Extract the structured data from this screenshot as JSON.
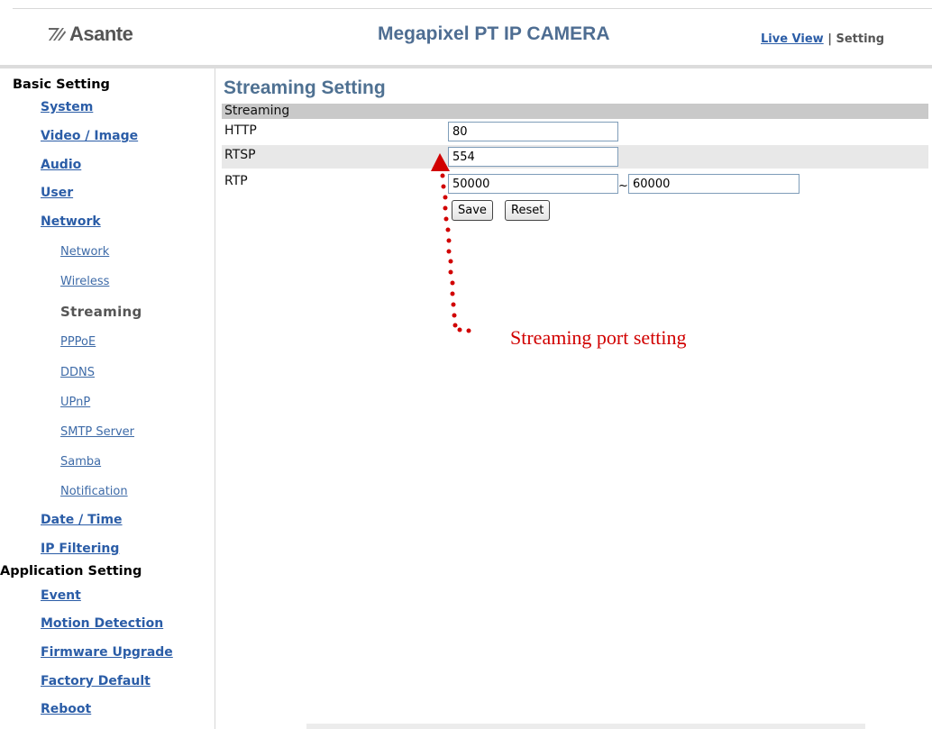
{
  "header": {
    "brand": "Asante",
    "product_title": "Megapixel PT IP CAMERA",
    "live_view_label": "Live View",
    "separator": " | ",
    "setting_label": "Setting"
  },
  "sidebar": {
    "basic_title": "Basic Setting",
    "app_title": "Application Setting",
    "items": {
      "system": "System",
      "video_image": "Video / Image",
      "audio": "Audio",
      "user": "User",
      "network": "Network",
      "network_sub": "Network",
      "wireless": "Wireless",
      "streaming": "Streaming",
      "pppoe": "PPPoE",
      "ddns": "DDNS",
      "upnp": "UPnP",
      "smtp": "SMTP Server",
      "samba": "Samba",
      "notification": "Notification",
      "date_time": "Date / Time",
      "ip_filtering": "IP Filtering",
      "event": "Event",
      "motion": "Motion Detection",
      "firmware": "Firmware Upgrade",
      "factory": "Factory Default",
      "reboot": "Reboot"
    }
  },
  "main": {
    "page_title": "Streaming Setting",
    "section_label": "Streaming",
    "rows": {
      "http_label": "HTTP",
      "http_value": "80",
      "rtsp_label": "RTSP",
      "rtsp_value": "554",
      "rtp_label": "RTP",
      "rtp_from": "50000",
      "rtp_separator": "~",
      "rtp_to": "60000"
    },
    "save_label": "Save",
    "reset_label": "Reset"
  },
  "annotation": {
    "text": "Streaming port setting",
    "color": "#d10000"
  },
  "colors": {
    "link": "#2b5da7",
    "title": "#4f7192",
    "section_bar": "#c9c9c9"
  }
}
